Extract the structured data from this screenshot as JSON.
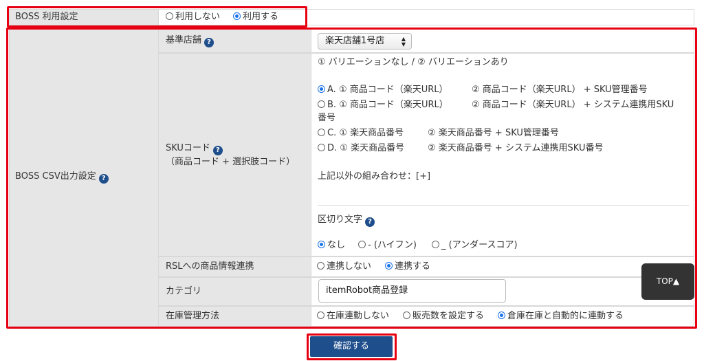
{
  "boss_usage": {
    "label": "BOSS 利用設定",
    "options": [
      "利用しない",
      "利用する"
    ],
    "selected": "利用する"
  },
  "boss_csv": {
    "label": "BOSS CSV出力設定",
    "base_store": {
      "label": "基準店舗",
      "value": "楽天店舗1号店"
    },
    "sku_code": {
      "label": "SKUコード",
      "sublabel": "（商品コード + 選択肢コード）",
      "legend": "① バリエーションなし / ② バリエーションあり",
      "options": [
        {
          "letter": "A.",
          "p1": "① 商品コード（楽天URL）",
          "p2": "② 商品コード（楽天URL） + SKU管理番号",
          "p2_cont": ""
        },
        {
          "letter": "B.",
          "p1": "① 商品コード（楽天URL）",
          "p2": "② 商品コード（楽天URL） + システム連携用SKU",
          "p2_cont": "番号"
        },
        {
          "letter": "C.",
          "p1": "① 楽天商品番号",
          "p2": "② 楽天商品番号 + SKU管理番号",
          "p2_cont": ""
        },
        {
          "letter": "D.",
          "p1": "① 楽天商品番号",
          "p2": "② 楽天商品番号 + システム連携用SKU番号",
          "p2_cont": ""
        }
      ],
      "selected_letter": "A.",
      "other_combo": "上記以外の組み合わせ：[+]"
    },
    "delimiter": {
      "label": "区切り文字",
      "options": [
        "なし",
        "- (ハイフン)",
        "_ (アンダースコア)"
      ],
      "selected": "なし"
    },
    "rsl": {
      "label": "RSLへの商品情報連携",
      "options": [
        "連携しない",
        "連携する"
      ],
      "selected": "連携する"
    },
    "category": {
      "label": "カテゴリ",
      "value": "itemRobot商品登録"
    },
    "stock": {
      "label": "在庫管理方法",
      "options": [
        "在庫連動しない",
        "販売数を設定する",
        "倉庫在庫と自動的に連動する"
      ],
      "selected": "倉庫在庫と自動的に連動する"
    }
  },
  "help_icon_glyph": "?",
  "top_button": "TOP▲",
  "confirm_button": "確認する",
  "colors": {
    "highlight": "#e60012",
    "primary": "#1f4e8c",
    "radio_selected": "#1a73e8"
  }
}
